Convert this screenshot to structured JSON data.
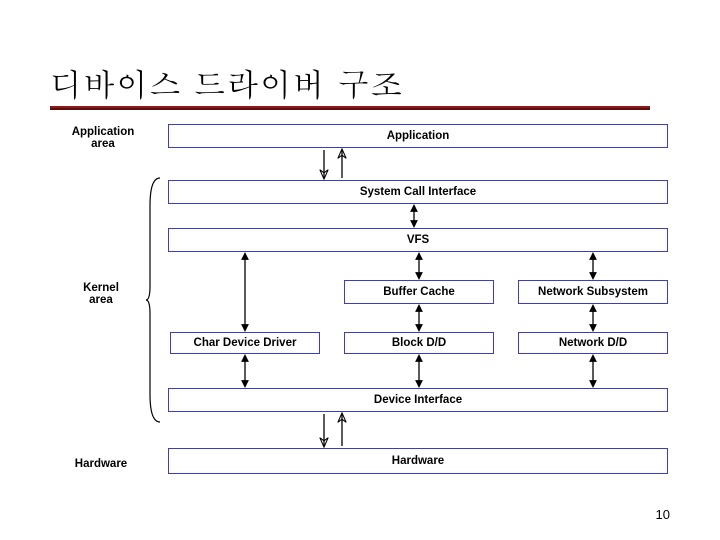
{
  "title": "디바이스 드라이버 구조",
  "page_number": "10",
  "labels": {
    "application_area": "Application\narea",
    "kernel_area": "Kernel\narea",
    "hardware_label": "Hardware"
  },
  "boxes": {
    "application": "Application",
    "sci": "System Call Interface",
    "vfs": "VFS",
    "buffer_cache": "Buffer Cache",
    "net_subsys": "Network Subsystem",
    "char_dd": "Char Device Driver",
    "block_dd": "Block D/D",
    "net_dd": "Network D/D",
    "device_if": "Device Interface",
    "hardware": "Hardware"
  },
  "chart_data": {
    "type": "diagram",
    "title": "디바이스 드라이버 구조",
    "regions": [
      {
        "name": "Application area",
        "contains": [
          "Application"
        ]
      },
      {
        "name": "Kernel area",
        "contains": [
          "System Call Interface",
          "VFS",
          "Buffer Cache",
          "Network Subsystem",
          "Char Device Driver",
          "Block D/D",
          "Network D/D",
          "Device Interface"
        ]
      },
      {
        "name": "Hardware",
        "contains": [
          "Hardware"
        ]
      }
    ],
    "nodes": [
      "Application",
      "System Call Interface",
      "VFS",
      "Buffer Cache",
      "Network Subsystem",
      "Char Device Driver",
      "Block D/D",
      "Network D/D",
      "Device Interface",
      "Hardware"
    ],
    "edges": [
      [
        "Application",
        "System Call Interface",
        "open-bidir"
      ],
      [
        "System Call Interface",
        "VFS",
        "bidir"
      ],
      [
        "VFS",
        "Char Device Driver",
        "bidir"
      ],
      [
        "VFS",
        "Buffer Cache",
        "bidir"
      ],
      [
        "VFS",
        "Network Subsystem",
        "bidir"
      ],
      [
        "Buffer Cache",
        "Block D/D",
        "bidir"
      ],
      [
        "Network Subsystem",
        "Network D/D",
        "bidir"
      ],
      [
        "Char Device Driver",
        "Device Interface",
        "bidir"
      ],
      [
        "Block D/D",
        "Device Interface",
        "bidir"
      ],
      [
        "Network D/D",
        "Device Interface",
        "bidir"
      ],
      [
        "Device Interface",
        "Hardware",
        "open-bidir"
      ]
    ]
  }
}
